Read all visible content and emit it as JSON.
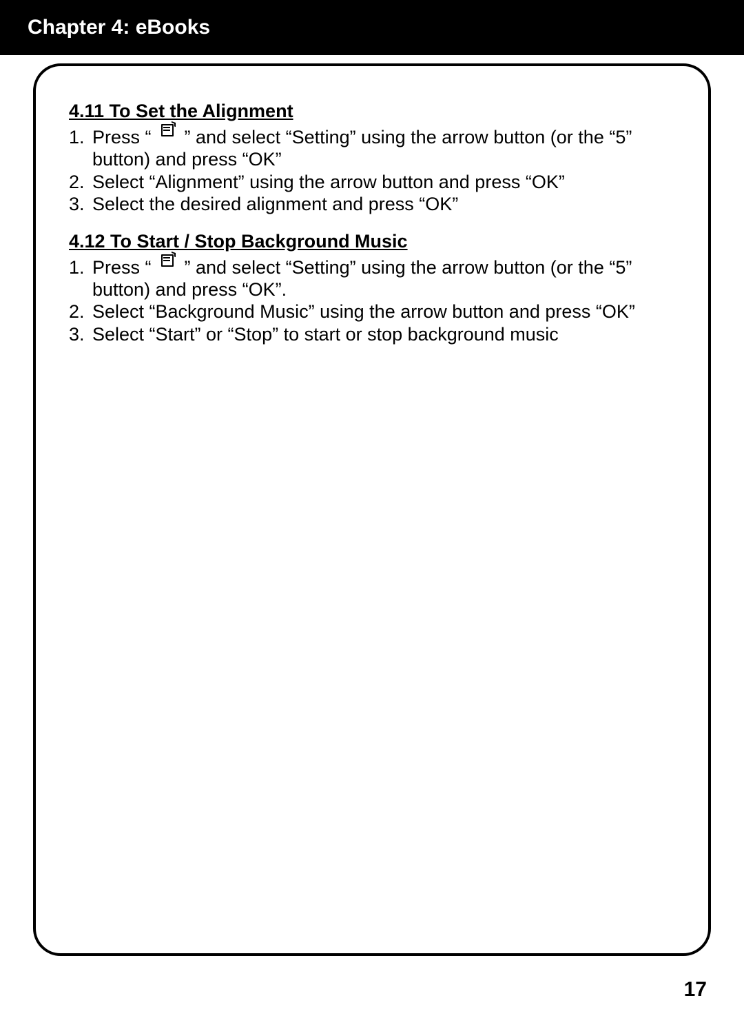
{
  "header": {
    "title": "Chapter 4: eBooks"
  },
  "sections": [
    {
      "heading": "4.11 To Set the Alignment",
      "steps": [
        {
          "num": "1.",
          "pre": "Press “",
          "post": "” and select “Setting” using the arrow button (or the “5” button) and press “OK”",
          "has_icon": true
        },
        {
          "num": "2.",
          "text": "Select “Alignment” using the arrow button and press “OK”"
        },
        {
          "num": "3.",
          "text": "Select the desired alignment and press “OK”"
        }
      ]
    },
    {
      "heading": "4.12 To Start / Stop Background Music",
      "steps": [
        {
          "num": "1.",
          "pre": "Press “",
          "post": "” and select “Setting” using the arrow button (or the “5” button) and press “OK”.",
          "has_icon": true
        },
        {
          "num": "2.",
          "text": "Select “Background Music” using the arrow button and press “OK”"
        },
        {
          "num": "3.",
          "text": "Select “Start” or “Stop” to start or stop background music"
        }
      ]
    }
  ],
  "page_number": "17"
}
